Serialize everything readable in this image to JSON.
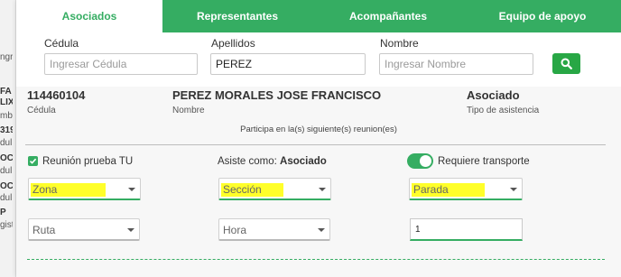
{
  "background": {
    "left_fragments": [
      {
        "text": "ngr",
        "bold": false
      },
      {
        "text": "FA",
        "bold": true
      },
      {
        "text": "LIX",
        "bold": true
      },
      {
        "text": "mb",
        "bold": false
      },
      {
        "text": "319",
        "bold": true
      },
      {
        "text": "dul",
        "bold": false
      },
      {
        "text": "OC",
        "bold": true
      },
      {
        "text": "dul",
        "bold": false
      },
      {
        "text": "OC",
        "bold": true
      },
      {
        "text": "dul",
        "bold": false
      },
      {
        "text": "P",
        "bold": true
      },
      {
        "text": "gist",
        "bold": false
      }
    ]
  },
  "tabs": [
    {
      "label": "Asociados",
      "active": true
    },
    {
      "label": "Representantes",
      "active": false
    },
    {
      "label": "Acompañantes",
      "active": false
    },
    {
      "label": "Equipo de apoyo",
      "active": false
    }
  ],
  "search": {
    "cedula_label": "Cédula",
    "cedula_placeholder": "Ingresar Cédula",
    "cedula_value": "",
    "apellidos_label": "Apellidos",
    "apellidos_value": "PEREZ",
    "nombre_label": "Nombre",
    "nombre_placeholder": "Ingresar Nombre",
    "nombre_value": "",
    "search_icon": "search-icon"
  },
  "result": {
    "cedula_value": "114460104",
    "cedula_caption": "Cédula",
    "nombre_value": "PEREZ MORALES JOSE FRANCISCO",
    "nombre_caption": "Nombre",
    "tipo_value": "Asociado",
    "tipo_caption": "Tipo de asistencia",
    "participa_text": "Participa en la(s) siguiente(s) reunion(es)",
    "meeting": {
      "checked": true,
      "name": "Reunión prueba TU",
      "asiste_label": "Asiste como:",
      "asiste_value": "Asociado",
      "transporte_label": "Requiere transporte",
      "transporte_on": true
    },
    "selects": {
      "zona": "Zona",
      "seccion": "Sección",
      "parada": "Parada",
      "ruta": "Ruta",
      "hora": "Hora"
    },
    "count_value": "1"
  },
  "colors": {
    "accent": "#35ad62",
    "button": "#28a745",
    "highlight": "#ffff2a"
  }
}
